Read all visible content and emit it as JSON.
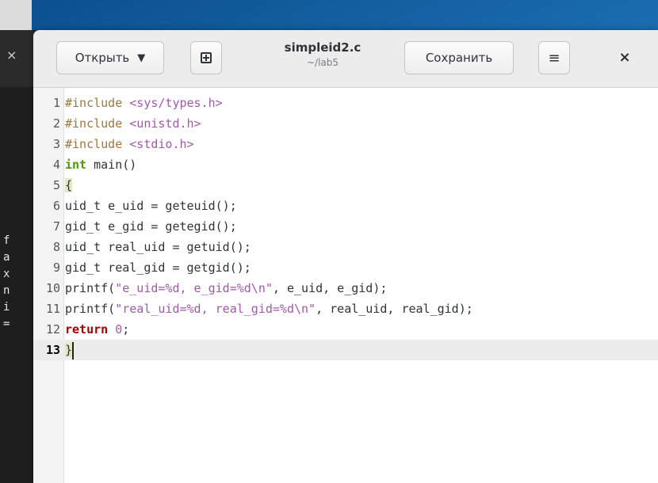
{
  "window": {
    "title": "simpleid2.c",
    "subtitle": "~/lab5"
  },
  "toolbar": {
    "open_label": "Открыть",
    "open_caret": "▼",
    "save_label": "Сохранить",
    "menu_icon": "≡",
    "close_icon": "×"
  },
  "terminal": {
    "close_icon": "×",
    "lines": [
      "f",
      "a",
      "x",
      "n",
      "i",
      "="
    ]
  },
  "editor": {
    "current_line": 13,
    "lines": [
      {
        "n": "1",
        "segments": [
          {
            "t": "#include ",
            "c": "pp"
          },
          {
            "t": "<sys/types.h>",
            "c": "inc"
          }
        ]
      },
      {
        "n": "2",
        "segments": [
          {
            "t": "#include ",
            "c": "pp"
          },
          {
            "t": "<unistd.h>",
            "c": "inc"
          }
        ]
      },
      {
        "n": "3",
        "segments": [
          {
            "t": "#include ",
            "c": "pp"
          },
          {
            "t": "<stdio.h>",
            "c": "inc"
          }
        ]
      },
      {
        "n": "4",
        "segments": [
          {
            "t": "int",
            "c": "type"
          },
          {
            "t": " main()",
            "c": ""
          }
        ]
      },
      {
        "n": "5",
        "segments": [
          {
            "t": "{",
            "c": "brace-hl"
          }
        ]
      },
      {
        "n": "6",
        "segments": [
          {
            "t": "uid_t e_uid = geteuid();",
            "c": ""
          }
        ]
      },
      {
        "n": "7",
        "segments": [
          {
            "t": "gid_t e_gid = getegid();",
            "c": ""
          }
        ]
      },
      {
        "n": "8",
        "segments": [
          {
            "t": "uid_t real_uid = getuid();",
            "c": ""
          }
        ]
      },
      {
        "n": "9",
        "segments": [
          {
            "t": "gid_t real_gid = getgid();",
            "c": ""
          }
        ]
      },
      {
        "n": "10",
        "segments": [
          {
            "t": "printf(",
            "c": ""
          },
          {
            "t": "\"e_uid=%d, e_gid=%d\\n\"",
            "c": "str"
          },
          {
            "t": ", e_uid, e_gid);",
            "c": ""
          }
        ]
      },
      {
        "n": "11",
        "segments": [
          {
            "t": "printf(",
            "c": ""
          },
          {
            "t": "\"real_uid=%d, real_gid=%d\\n\"",
            "c": "str"
          },
          {
            "t": ", real_uid, real_gid);",
            "c": ""
          }
        ]
      },
      {
        "n": "12",
        "segments": [
          {
            "t": "return",
            "c": "kw"
          },
          {
            "t": " ",
            "c": ""
          },
          {
            "t": "0",
            "c": "num"
          },
          {
            "t": ";",
            "c": ""
          }
        ]
      },
      {
        "n": "13",
        "segments": [
          {
            "t": "}",
            "c": "brace-hl"
          }
        ]
      }
    ]
  },
  "colors": {
    "keyword": "#a40000",
    "type": "#4e9a06",
    "preprocessor": "#a0763d",
    "string": "#a05aa8",
    "current_line_bg": "#ececec"
  }
}
